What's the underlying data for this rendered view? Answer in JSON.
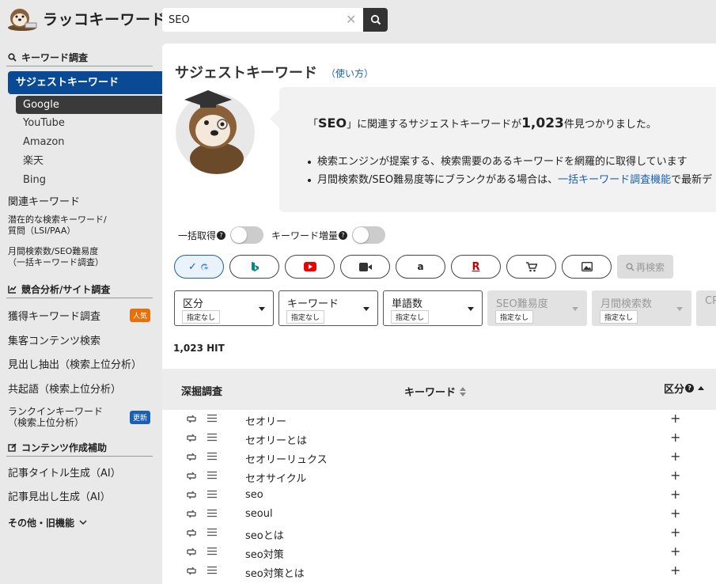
{
  "app": {
    "name": "ラッコキーワード"
  },
  "search": {
    "value": "SEO",
    "clear_icon": "close-icon",
    "submit_icon": "search-icon"
  },
  "sidebar": {
    "sections": [
      {
        "title": "キーワード調査",
        "icon": "search-icon"
      },
      {
        "title": "競合分析/サイト調査",
        "icon": "chart-icon"
      },
      {
        "title": "コンテンツ作成補助",
        "icon": "edit-icon"
      },
      {
        "title": "その他・旧機能",
        "icon": "chevron-down-icon"
      }
    ],
    "active_item": "サジェストキーワード",
    "sub_items": [
      "Google",
      "YouTube",
      "Amazon",
      "楽天",
      "Bing"
    ],
    "kw_items": [
      "関連キーワード",
      "潜在的な検索キーワード/",
      "質問（LSI/PAA）",
      "月間検索数/SEO難易度",
      "（一括キーワード調査）"
    ],
    "comp_items": [
      {
        "label": "獲得キーワード調査",
        "badge": "人気",
        "badge_color": "#e8700a"
      },
      {
        "label": "集客コンテンツ検索"
      },
      {
        "label": "見出し抽出（検索上位分析）"
      },
      {
        "label": "共起語（検索上位分析）"
      },
      {
        "label": "ランクインキーワード",
        "label2": "（検索上位分析）",
        "badge": "更新",
        "badge_color": "#1a5fb4"
      }
    ],
    "content_items": [
      "記事タイトル生成（AI）",
      "記事見出し生成（AI）"
    ]
  },
  "main": {
    "title": "サジェストキーワード",
    "howto": "（使い方）",
    "info": {
      "pre": "「",
      "keyword": "SEO",
      "mid": "」に関連するサジェストキーワードが",
      "count": "1,023",
      "post": "件見つかりました。",
      "bullet1": "検索エンジンが提案する、検索需要のあるキーワードを網羅的に取得しています",
      "bullet2_pre": "月間検索数/SEO難易度等にブランクがある場合は、",
      "bullet2_link": "一括キーワード調査機能",
      "bullet2_post": "で最新デ"
    },
    "toggles": [
      {
        "label": "一括取得",
        "on": false
      },
      {
        "label": "キーワード増量",
        "on": false
      }
    ],
    "engines": [
      "google",
      "bing",
      "youtube",
      "video",
      "amazon",
      "rakuten",
      "shopping",
      "image"
    ],
    "research_label": "再検索",
    "filters": [
      {
        "label": "区分",
        "sub": "指定なし",
        "disabled": false
      },
      {
        "label": "キーワード",
        "sub": "指定なし",
        "disabled": false
      },
      {
        "label": "単語数",
        "sub": "指定なし",
        "disabled": false
      },
      {
        "label": "SEO難易度",
        "sub": "指定なし",
        "disabled": true
      },
      {
        "label": "月間検索数",
        "sub": "指定なし",
        "disabled": true
      },
      {
        "label": "CP",
        "sub": "",
        "disabled": true
      }
    ],
    "hit": "1,023 HIT",
    "table": {
      "headers": [
        "深掘調査",
        "キーワード",
        "区分"
      ],
      "rows": [
        "セオリー",
        "セオリーとは",
        "セオリーリュクス",
        "セオサイクル",
        "seo",
        "seoul",
        "seoとは",
        "seo対策",
        "seo対策とは"
      ]
    }
  },
  "colors": {
    "brand": "#0a4a94",
    "link": "#1a5fb4",
    "sidebar_bg": "#e9e9e9"
  }
}
